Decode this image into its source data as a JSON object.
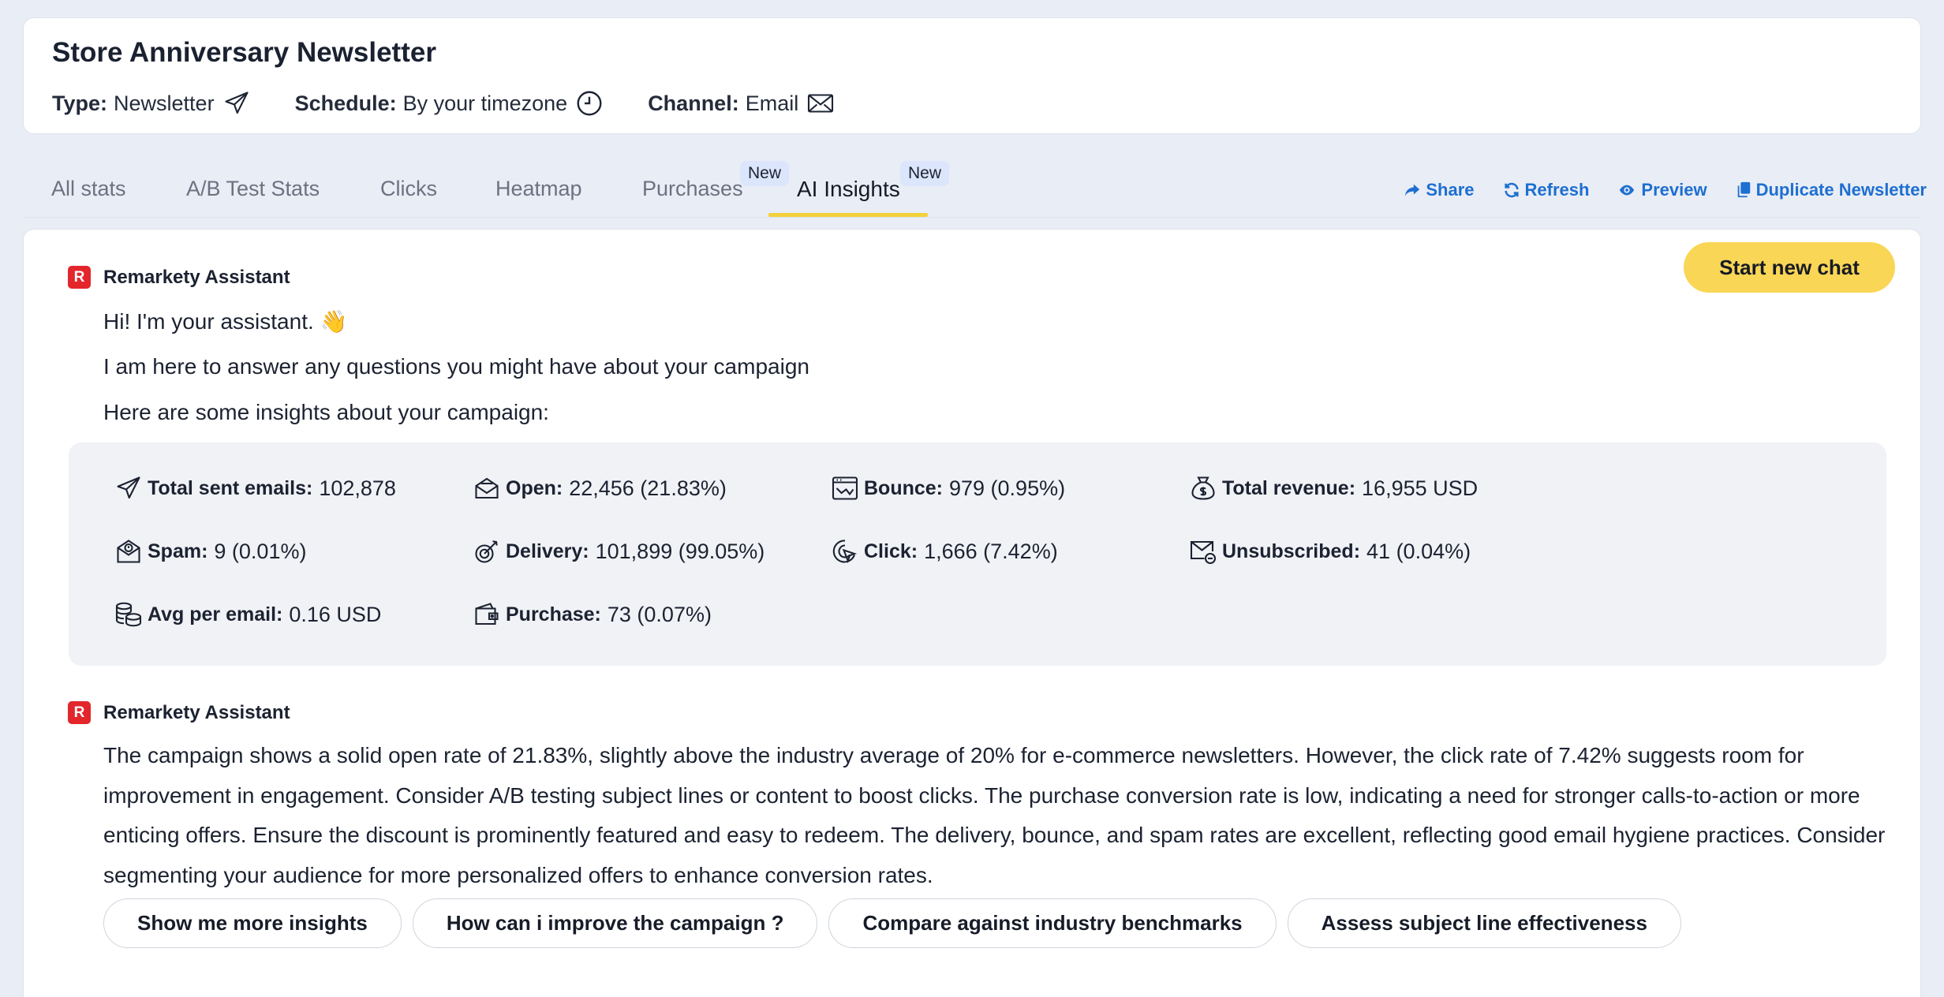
{
  "campaign": {
    "title": "Store Anniversary Newsletter",
    "type_label": "Type:",
    "type_value": "Newsletter",
    "schedule_label": "Schedule:",
    "schedule_value": "By your timezone",
    "channel_label": "Channel:",
    "channel_value": "Email"
  },
  "tabs": [
    {
      "label": "All stats"
    },
    {
      "label": "A/B Test Stats"
    },
    {
      "label": "Clicks"
    },
    {
      "label": "Heatmap"
    },
    {
      "label": "Purchases",
      "badge": "New"
    },
    {
      "label": "AI Insights",
      "badge": "New",
      "active": true
    }
  ],
  "actions": {
    "share": "Share",
    "refresh": "Refresh",
    "preview": "Preview",
    "duplicate": "Duplicate Newsletter"
  },
  "chat": {
    "start_new_chat": "Start new chat",
    "assistant_name": "Remarkety Assistant",
    "logo_letter": "R",
    "greeting": "Hi! I'm your assistant. 👋",
    "intro": "I am here to answer any questions you might have about your campaign",
    "insights_intro": "Here are some insights about your campaign:",
    "analysis": "The campaign shows a solid open rate of 21.83%, slightly above the industry average of 20% for e-commerce newsletters. However, the click rate of 7.42% suggests room for improvement in engagement. Consider A/B testing subject lines or content to boost clicks. The purchase conversion rate is low, indicating a need for stronger calls-to-action or more enticing offers. Ensure the discount is prominently featured and easy to redeem. The delivery, bounce, and spam rates are excellent, reflecting good email hygiene practices. Consider segmenting your audience for more personalized offers to enhance conversion rates."
  },
  "stats": {
    "total_sent": {
      "label": "Total sent emails:",
      "value": "102,878",
      "icon": "send-icon"
    },
    "open": {
      "label": "Open:",
      "value": "22,456 (21.83%)",
      "icon": "open-envelope-icon"
    },
    "bounce": {
      "label": "Bounce:",
      "value": "979 (0.95%)",
      "icon": "bounce-icon"
    },
    "revenue": {
      "label": "Total revenue:",
      "value": "16,955 USD",
      "icon": "money-bag-icon"
    },
    "spam": {
      "label": "Spam:",
      "value": "9 (0.01%)",
      "icon": "spam-icon"
    },
    "delivery": {
      "label": "Delivery:",
      "value": "101,899 (99.05%)",
      "icon": "target-icon"
    },
    "click": {
      "label": "Click:",
      "value": "1,666 (7.42%)",
      "icon": "click-icon"
    },
    "unsubscribed": {
      "label": "Unsubscribed:",
      "value": "41 (0.04%)",
      "icon": "unsubscribe-icon"
    },
    "avg_per_email": {
      "label": "Avg per email:",
      "value": "0.16 USD",
      "icon": "coins-icon"
    },
    "purchase": {
      "label": "Purchase:",
      "value": "73 (0.07%)",
      "icon": "wallet-icon"
    }
  },
  "suggestions": [
    "Show me more insights",
    "How can i improve the campaign ?",
    "Compare against industry benchmarks",
    "Assess subject line effectiveness"
  ],
  "colors": {
    "accent_yellow": "#fad656",
    "link_blue": "#1d6fd1",
    "badge_bg": "#dbe5fb",
    "logo_red": "#e2262b"
  }
}
